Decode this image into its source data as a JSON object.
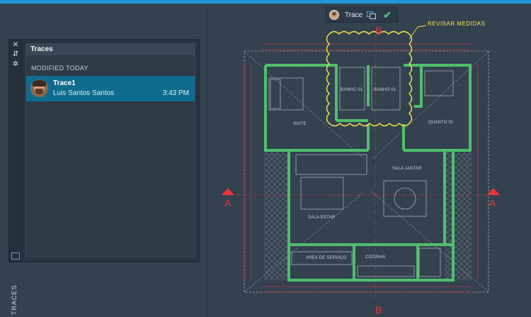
{
  "toolbar": {
    "label": "Trace",
    "accept_icon": "check-icon",
    "markup_icon": "markup-icon"
  },
  "palette": {
    "side_label": "TRACES",
    "close_icon": "close-icon",
    "pin_icon": "autohide-icon",
    "settings_icon": "settings-icon",
    "title": "Traces",
    "section": "MODIFIED TODAY",
    "items": [
      {
        "name": "Trace1",
        "user": "Luis Santos Santos",
        "time": "3:43 PM"
      }
    ]
  },
  "drawing": {
    "annotation": "REVISAR MEDIDAS",
    "section_a_left": "A",
    "section_a_right": "A",
    "section_b_top": "B",
    "section_b_bottom": "B",
    "rooms": {
      "suite": "SUITE",
      "banho1": "BANHO 01",
      "banho2": "BANHO 01",
      "quarto": "QUARTO 01",
      "sala_jantar": "SALA JANTAR",
      "sala_estar": "SALA ESTAR",
      "area_servico": "AREA DE SERVIÇO",
      "cozinha": "COZINHA"
    },
    "colors": {
      "wall": "#4fbf6d",
      "annotation": "#f2e94a",
      "dimension": "#e8343b",
      "background": "#34414f"
    }
  }
}
